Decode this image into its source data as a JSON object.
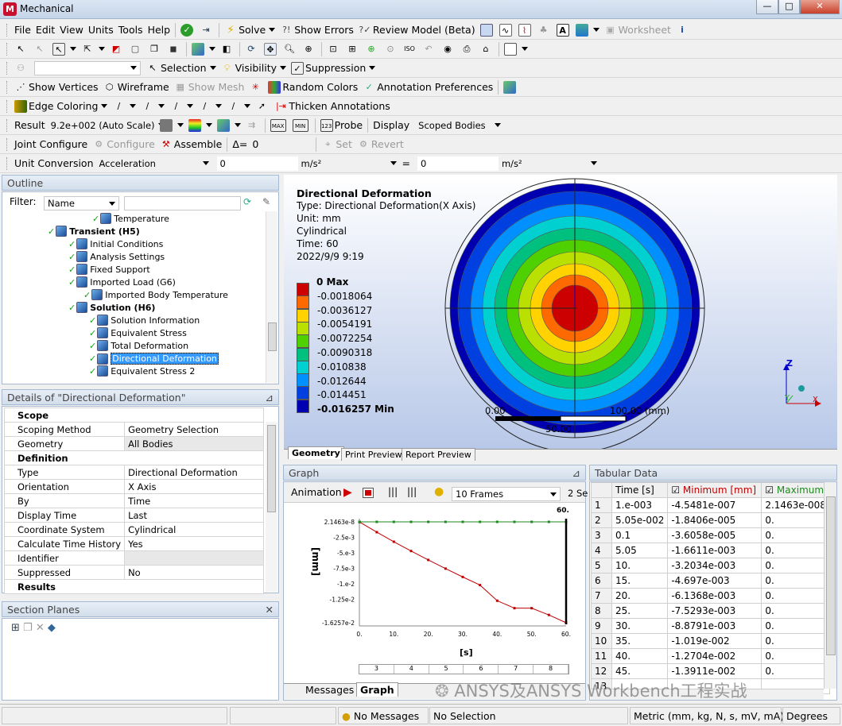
{
  "window": {
    "title": "Mechanical",
    "logo": "M"
  },
  "menu": [
    "File",
    "Edit",
    "View",
    "Units",
    "Tools",
    "Help"
  ],
  "toolbar1": {
    "solve": "Solve",
    "show_errors": "Show Errors",
    "review_model": "Review Model (Beta)",
    "worksheet": "Worksheet"
  },
  "toolbar3": {
    "selection": "Selection",
    "visibility": "Visibility",
    "suppression": "Suppression"
  },
  "toolbar4": {
    "show_vertices": "Show Vertices",
    "wireframe": "Wireframe",
    "show_mesh": "Show Mesh",
    "random_colors": "Random Colors",
    "annotation_prefs": "Annotation Preferences"
  },
  "toolbar5": {
    "edge_coloring": "Edge Coloring",
    "thicken": "Thicken Annotations"
  },
  "toolbar6": {
    "result_label": "Result",
    "scale": "9.2e+002 (Auto Scale)",
    "probe": "Probe",
    "display_label": "Display",
    "display_value": "Scoped Bodies"
  },
  "toolbar7": {
    "joint_configure": "Joint Configure",
    "configure": "Configure",
    "assemble": "Assemble",
    "delta": "Δ=",
    "delta_val": "0",
    "set": "Set",
    "revert": "Revert"
  },
  "toolbar8": {
    "unit_conversion": "Unit Conversion",
    "quantity": "Acceleration",
    "val1": "0",
    "unit1": "m/s²",
    "eq": "=",
    "val2": "0",
    "unit2": "m/s²"
  },
  "outline": {
    "title": "Outline",
    "filter_label": "Filter:",
    "filter_value": "Name",
    "items": [
      {
        "label": "Temperature",
        "bold": false
      },
      {
        "label": "Transient (H5)",
        "bold": true
      },
      {
        "label": "Initial Conditions",
        "bold": false
      },
      {
        "label": "Analysis Settings",
        "bold": false
      },
      {
        "label": "Fixed Support",
        "bold": false
      },
      {
        "label": "Imported Load (G6)",
        "bold": false
      },
      {
        "label": "Imported Body Temperature",
        "bold": false
      },
      {
        "label": "Solution (H6)",
        "bold": true
      },
      {
        "label": "Solution Information",
        "bold": false
      },
      {
        "label": "Equivalent Stress",
        "bold": false
      },
      {
        "label": "Total Deformation",
        "bold": false
      },
      {
        "label": "Directional Deformation",
        "bold": false
      },
      {
        "label": "Equivalent Stress 2",
        "bold": false
      }
    ]
  },
  "details": {
    "title": "Details of \"Directional Deformation\"",
    "rows": [
      {
        "cat": "Scope"
      },
      {
        "k": "Scoping Method",
        "v": "Geometry Selection"
      },
      {
        "k": "Geometry",
        "v": "All Bodies"
      },
      {
        "cat": "Definition"
      },
      {
        "k": "Type",
        "v": "Directional Deformation"
      },
      {
        "k": "Orientation",
        "v": "X Axis"
      },
      {
        "k": "By",
        "v": "Time"
      },
      {
        "k": "Display Time",
        "v": "Last"
      },
      {
        "k": "Coordinate System",
        "v": "Cylindrical"
      },
      {
        "k": "Calculate Time History",
        "v": "Yes"
      },
      {
        "k": "Identifier",
        "v": ""
      },
      {
        "k": "Suppressed",
        "v": "No"
      },
      {
        "cat": "Results"
      }
    ]
  },
  "section_planes": {
    "title": "Section Planes"
  },
  "viewport": {
    "title": "Directional Deformation",
    "type": "Type: Directional Deformation(X Axis)",
    "unit": "Unit: mm",
    "cs": "Cylindrical",
    "time": "Time: 60",
    "date": "2022/9/9 9:19",
    "legend": [
      "0 Max",
      "-0.0018064",
      "-0.0036127",
      "-0.0054191",
      "-0.0072254",
      "-0.0090318",
      "-0.010838",
      "-0.012644",
      "-0.014451",
      "-0.016257 Min"
    ],
    "legend_colors": [
      "#cc0000",
      "#ff6a00",
      "#ffd200",
      "#b9e000",
      "#4fd000",
      "#00c080",
      "#00d0d0",
      "#0090ff",
      "#0040e0",
      "#0000b0"
    ],
    "scale_left": "0.00",
    "scale_right": "100.00 (mm)",
    "scale_mid": "50.00",
    "axis_z": "Z",
    "axis_y": "Y",
    "axis_x": "X",
    "tabs": [
      "Geometry",
      "Print Preview",
      "Report Preview"
    ]
  },
  "graph": {
    "title": "Graph",
    "animation": "Animation",
    "frames": "10 Frames",
    "period": "2 Se",
    "ylabel": "[mm]",
    "xlabel": "[s]",
    "marker": "60.",
    "steps": [
      "3",
      "4",
      "5",
      "6",
      "7",
      "8"
    ],
    "tabs": [
      "Messages",
      "Graph"
    ]
  },
  "chart_data": {
    "type": "line",
    "x": [
      0.001,
      0.0505,
      0.1,
      5.05,
      10,
      15,
      20,
      25,
      30,
      35,
      40,
      45,
      50,
      55,
      60
    ],
    "series": [
      {
        "name": "Minimum [mm]",
        "values": [
          -4.5481e-07,
          -1.8406e-05,
          -3.6058e-05,
          -0.0016611,
          -0.0032034,
          -0.004697,
          -0.0061368,
          -0.0075293,
          -0.0088791,
          -0.01019,
          -0.012704,
          -0.013911,
          -0.013911,
          -0.015,
          -0.016257
        ],
        "color": "#c00000"
      },
      {
        "name": "Maximum [mm]",
        "values": [
          2.1463e-08,
          0,
          0,
          0,
          0,
          0,
          0,
          0,
          0,
          0,
          0,
          0,
          0,
          0,
          0
        ],
        "color": "#1e8a1e"
      }
    ],
    "yticks": [
      "2.1463e-8",
      "-2.5e-3",
      "-5.e-3",
      "-7.5e-3",
      "-1.e-2",
      "-1.25e-2",
      "-1.6257e-2"
    ],
    "xticks": [
      "0.",
      "10.",
      "20.",
      "30.",
      "40.",
      "50.",
      "60."
    ],
    "ylim": [
      -0.016257,
      2.1463e-08
    ],
    "xlim": [
      0,
      60
    ]
  },
  "tabular": {
    "title": "Tabular Data",
    "headers": [
      "",
      "Time [s]",
      "Minimum [mm]",
      "Maximum"
    ],
    "rows": [
      [
        "1",
        "1.e-003",
        "-4.5481e-007",
        "2.1463e-008"
      ],
      [
        "2",
        "5.05e-002",
        "-1.8406e-005",
        "0."
      ],
      [
        "3",
        "0.1",
        "-3.6058e-005",
        "0."
      ],
      [
        "4",
        "5.05",
        "-1.6611e-003",
        "0."
      ],
      [
        "5",
        "10.",
        "-3.2034e-003",
        "0."
      ],
      [
        "6",
        "15.",
        "-4.697e-003",
        "0."
      ],
      [
        "7",
        "20.",
        "-6.1368e-003",
        "0."
      ],
      [
        "8",
        "25.",
        "-7.5293e-003",
        "0."
      ],
      [
        "9",
        "30.",
        "-8.8791e-003",
        "0."
      ],
      [
        "10",
        "35.",
        "-1.019e-002",
        "0."
      ],
      [
        "11",
        "40.",
        "-1.2704e-002",
        "0."
      ],
      [
        "12",
        "45.",
        "-1.3911e-002",
        "0."
      ],
      [
        "13",
        "",
        "",
        ""
      ]
    ]
  },
  "watermark": "ANSYS及ANSYS Workbench工程实战",
  "status": {
    "messages": "No Messages",
    "selection": "No Selection",
    "units": "Metric (mm, kg, N, s, mV, mA)",
    "degrees": "Degrees"
  }
}
